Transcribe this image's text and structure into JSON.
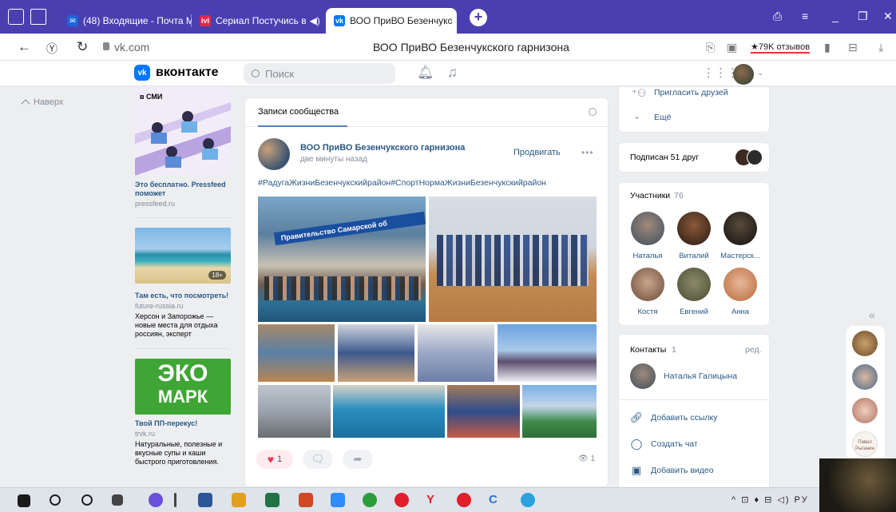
{
  "browser": {
    "tabs": [
      {
        "label": "(48) Входящие - Почта Ма",
        "favicon": "mail-icon",
        "color": "#1e63d8"
      },
      {
        "label": "Сериал Постучись в",
        "favicon": "ivi-icon",
        "color": "#e5264b",
        "extra": "◀)"
      },
      {
        "label": "ВОО ПриВО Безенчукс",
        "favicon": "vk-icon",
        "color": "#0077ff",
        "active": true
      }
    ],
    "url": "vk.com",
    "page_title": "ВОО ПриВО Безенчукского гарнизона",
    "reviews": "★79K отзывов"
  },
  "vk": {
    "logo_text": "вконтакте",
    "logo_mark": "vk",
    "search_placeholder": "Поиск"
  },
  "left": {
    "up_label": "Наверх",
    "ads": [
      {
        "badge": "в СМИ",
        "title": "Это бесплатно. Pressfeed поможет",
        "domain": "pressfeed.ru"
      },
      {
        "badge": "18+",
        "title": "Там есть, что посмотреть!",
        "domain": "future-russia.ru",
        "desc": "Херсон и Запорожье — новые места для отдыха россиян, эксперт"
      },
      {
        "logo_top": "ЭКО",
        "logo_bottom": "МАРК",
        "title": "Твой ПП-перекус!",
        "domain": "trvk.ru",
        "desc": "Натуральные, полезные и вкусные супы и каши быстрого приготовления."
      }
    ]
  },
  "post": {
    "tab_label": "Записи сообщества",
    "author": "ВОО ПриВО Безенчукского гарнизона",
    "time": "две минуты назад",
    "promote": "Продвигать",
    "more": "•••",
    "hashtags": "#РадугаЖизниБезенчукскийрайон#СпортНормаЖизниБезенчукскийрайон",
    "photo_banner": "Правительство Самарской об",
    "likes": "1",
    "views": "1"
  },
  "right": {
    "invite": "Пригласить друзей",
    "more": "Ещё",
    "subscribed": "Подписан 51 друг",
    "members_title": "Участники",
    "members_count": "76",
    "members": [
      {
        "name": "Наталья",
        "color": "#5b6a7a"
      },
      {
        "name": "Виталий",
        "color": "#3a2418"
      },
      {
        "name": "Мастерск...",
        "color": "#1a1a1a"
      },
      {
        "name": "Костя",
        "color": "#8a6d5a"
      },
      {
        "name": "Евгений",
        "color": "#6b6a4a"
      },
      {
        "name": "Анна",
        "color": "#c98f6a"
      }
    ],
    "contacts_title": "Контакты",
    "contacts_count": "1",
    "contacts_edit": "ред.",
    "contact_name": "Наталья Галицына",
    "actions": [
      "Добавить ссылку",
      "Создать чат",
      "Добавить видео"
    ]
  },
  "chats": {
    "logo_text": "Павел Рыганин"
  },
  "taskbar": {
    "tray_text": "^ ⊡ ♦ ⊟ ◁) РУ"
  }
}
